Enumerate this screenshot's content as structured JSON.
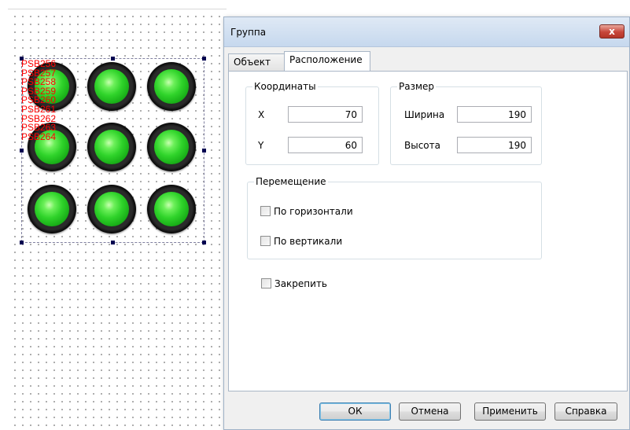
{
  "canvas": {
    "tags": [
      "PSB256",
      "PSB257",
      "PSB258",
      "PSB259",
      "PSB260",
      "PSB261",
      "PSB262",
      "PSB263",
      "PSB264"
    ],
    "lamp_color": "#2fd32a",
    "tag_color": "#ff0000"
  },
  "dialog": {
    "title": "Группа",
    "close_label": "x",
    "tabs": [
      {
        "label": "Объект",
        "active": false
      },
      {
        "label": "Расположение",
        "active": true
      }
    ],
    "coordinates": {
      "title": "Координаты",
      "x_label": "X",
      "x_value": "70",
      "y_label": "Y",
      "y_value": "60"
    },
    "size": {
      "title": "Размер",
      "width_label": "Ширина",
      "width_value": "190",
      "height_label": "Высота",
      "height_value": "190"
    },
    "movement": {
      "title": "Перемещение",
      "horizontal_label": "По горизонтали",
      "horizontal_checked": false,
      "vertical_label": "По вертикали",
      "vertical_checked": false
    },
    "lock": {
      "label": "Закрепить",
      "checked": false
    },
    "buttons": {
      "ok": "ОК",
      "cancel": "Отмена",
      "apply": "Применить",
      "help": "Справка"
    }
  }
}
